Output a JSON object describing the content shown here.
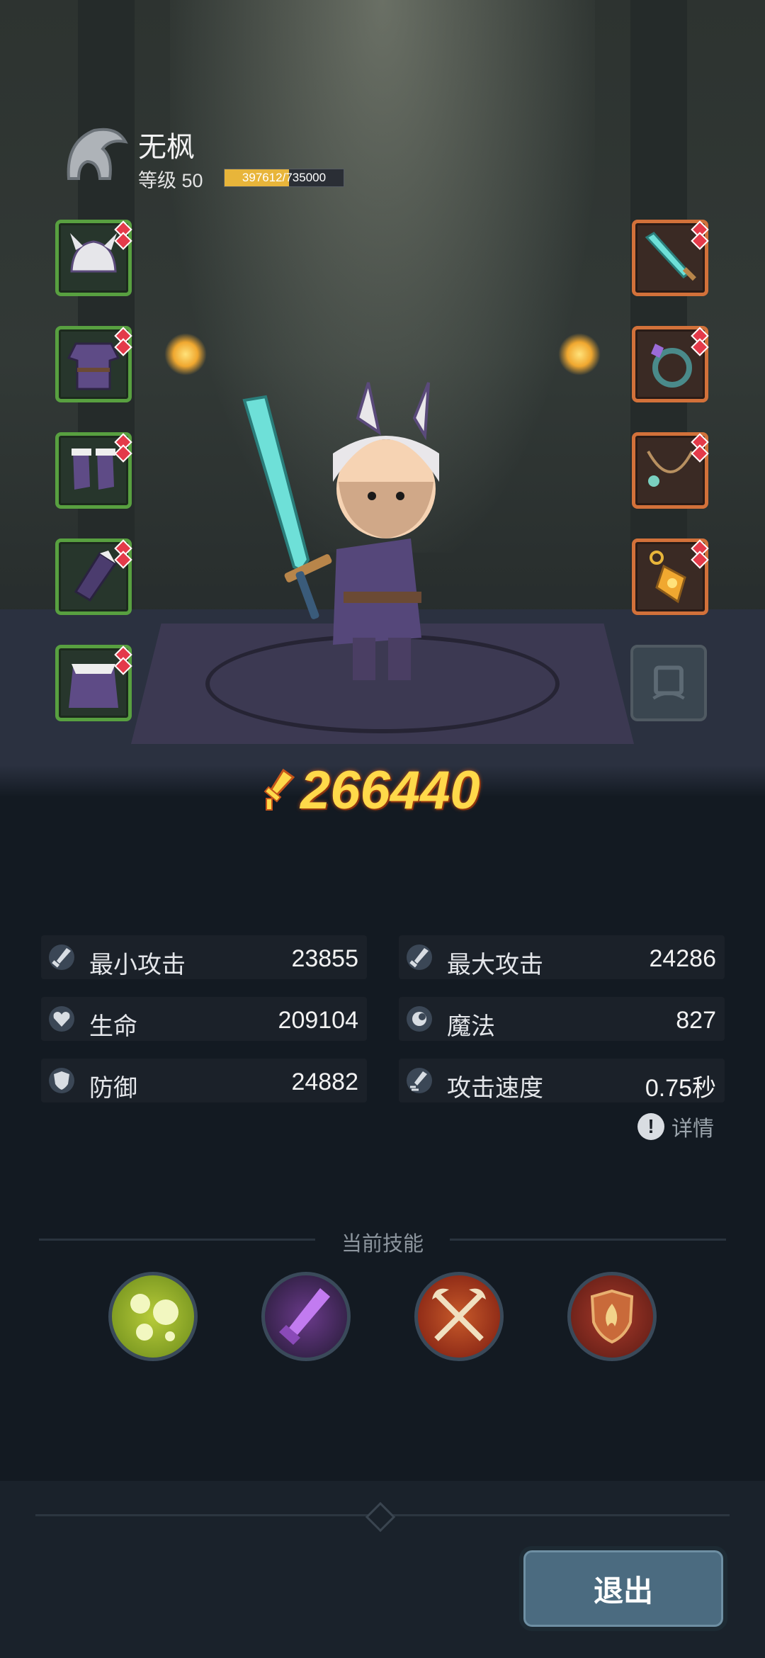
{
  "player": {
    "name": "无枫",
    "level_label": "等级 50",
    "xp_text": "397612/735000",
    "xp_progress": 0.541
  },
  "power": {
    "value": "266440",
    "icon": "sword-power-icon"
  },
  "equipment": {
    "left": [
      "helmet",
      "armor",
      "boots",
      "gauntlets",
      "cape"
    ],
    "right": [
      "weapon",
      "ring",
      "necklace",
      "amulet"
    ]
  },
  "stats": [
    {
      "label": "最小攻击",
      "value": "23855",
      "icon": "sword-icon"
    },
    {
      "label": "最大攻击",
      "value": "24286",
      "icon": "sword-icon"
    },
    {
      "label": "生命",
      "value": "209104",
      "icon": "heart-icon"
    },
    {
      "label": "魔法",
      "value": "827",
      "icon": "mana-icon"
    },
    {
      "label": "防御",
      "value": "24882",
      "icon": "shield-icon"
    },
    {
      "label": "攻击速度",
      "value": "0.75秒",
      "icon": "speed-icon"
    }
  ],
  "details_label": "详情",
  "skills": {
    "title": "当前技能",
    "items": [
      "poison-bubbles",
      "shadow-blade",
      "crossed-axes",
      "flame-shield"
    ]
  },
  "exit_label": "退出",
  "colors": {
    "gold": "#ffd94a",
    "green_slot": "#58a040",
    "orange_slot": "#d2713a",
    "button": "#4b6b80"
  }
}
